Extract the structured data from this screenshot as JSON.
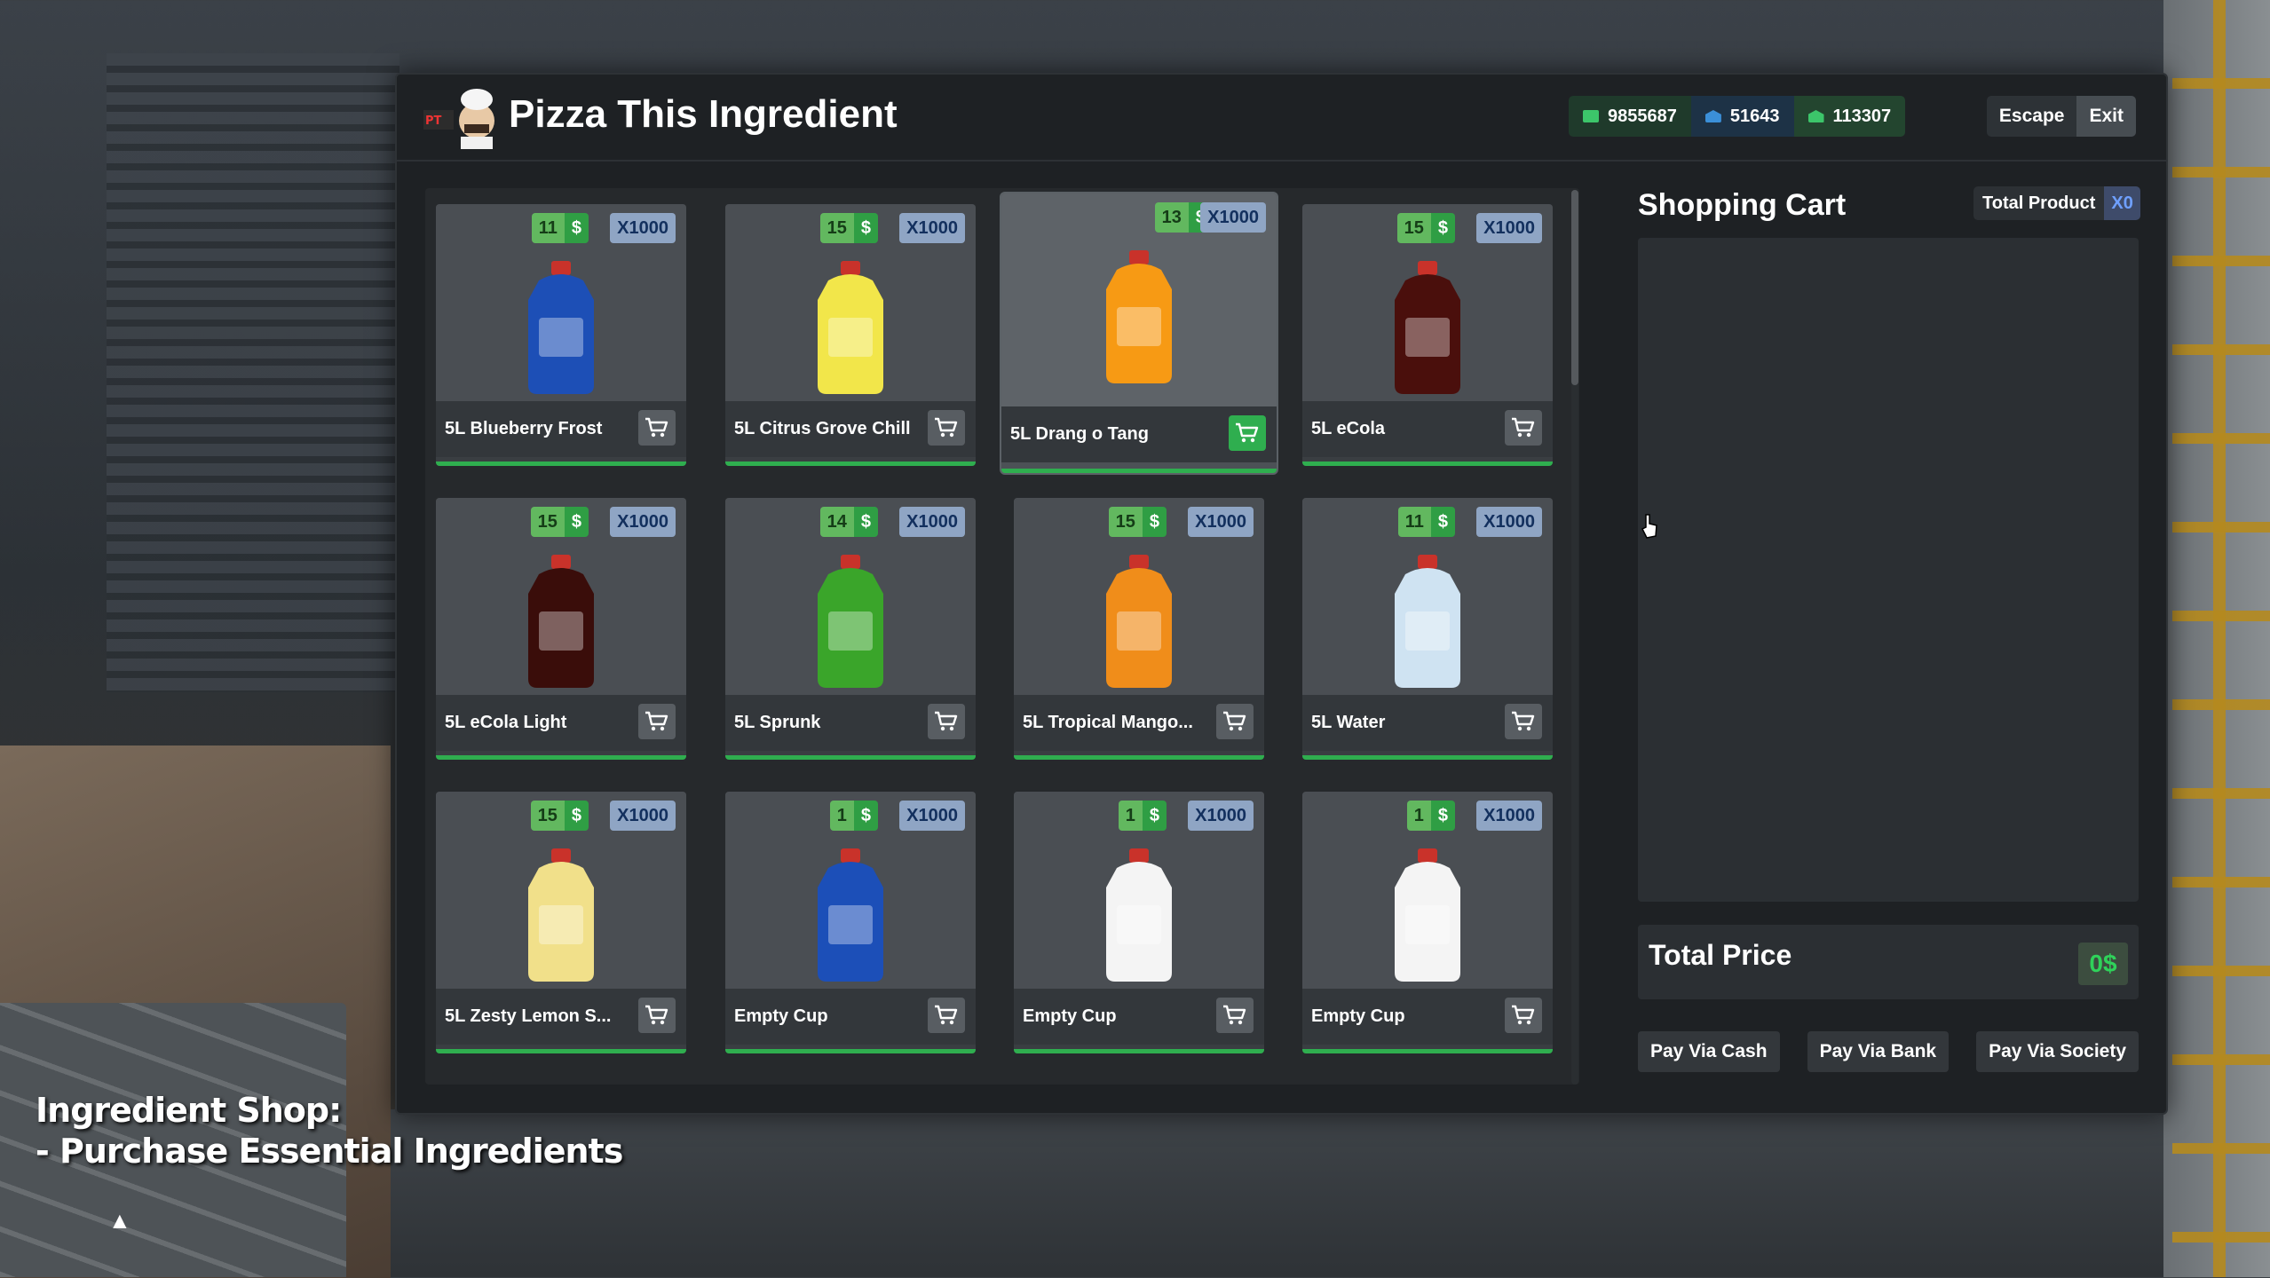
{
  "app": {
    "title": "Pizza This Ingredient"
  },
  "wallet": {
    "cash": "9855687",
    "bank": "51643",
    "society": "113307"
  },
  "header_buttons": {
    "escape": "Escape",
    "exit": "Exit"
  },
  "currency_symbol": "$",
  "products": [
    {
      "name": "5L Blueberry Frost",
      "price": "11",
      "qty": "X1000",
      "color": "#1d4fb6"
    },
    {
      "name": "5L Citrus Grove Chill",
      "price": "15",
      "qty": "X1000",
      "color": "#f2e64a"
    },
    {
      "name": "5L Drang o Tang",
      "price": "13",
      "qty": "X1000",
      "color": "#f79a14"
    },
    {
      "name": "5L eCola",
      "price": "15",
      "qty": "X1000",
      "color": "#4a0f0c"
    },
    {
      "name": "5L eCola Light",
      "price": "15",
      "qty": "X1000",
      "color": "#3a0d0a"
    },
    {
      "name": "5L Sprunk",
      "price": "14",
      "qty": "X1000",
      "color": "#3aa52a"
    },
    {
      "name": "5L Tropical Mango...",
      "price": "15",
      "qty": "X1000",
      "color": "#f08d1a"
    },
    {
      "name": "5L Water",
      "price": "11",
      "qty": "X1000",
      "color": "#cfe3f2"
    },
    {
      "name": "5L Zesty Lemon S...",
      "price": "15",
      "qty": "X1000",
      "color": "#f1e08a"
    },
    {
      "name": "Empty Cup",
      "price": "1",
      "qty": "X1000",
      "color": "#1c4fb8"
    },
    {
      "name": "Empty Cup",
      "price": "1",
      "qty": "X1000",
      "color": "#f4f4f4"
    },
    {
      "name": "Empty Cup",
      "price": "1",
      "qty": "X1000",
      "color": "#f4f4f4"
    }
  ],
  "cart": {
    "title": "Shopping Cart",
    "total_product_label": "Total Product",
    "total_product_value": "X0",
    "total_price_label": "Total Price",
    "total_price_value": "0$"
  },
  "pay_buttons": {
    "cash": "Pay Via Cash",
    "bank": "Pay Via Bank",
    "society": "Pay Via Society"
  },
  "caption": {
    "line1": "Ingredient Shop:",
    "line2": "- Purchase Essential Ingredients"
  }
}
